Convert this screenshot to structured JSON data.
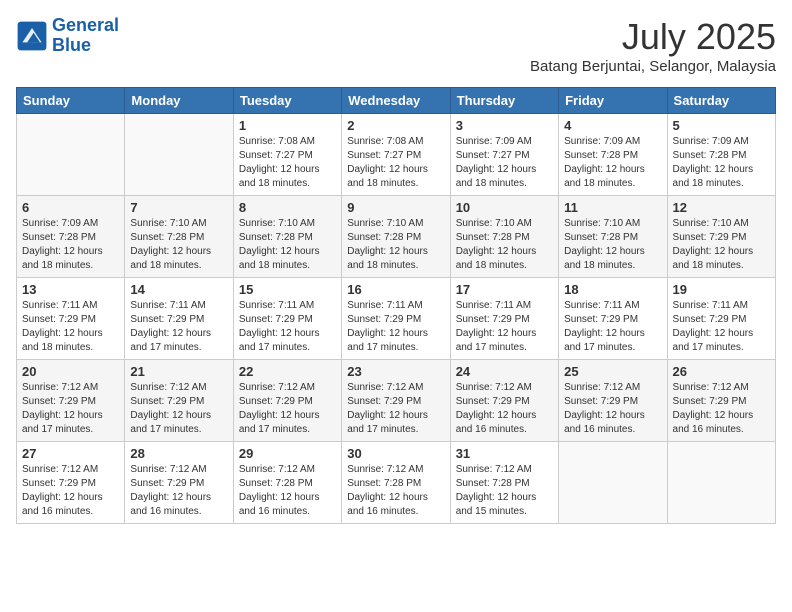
{
  "header": {
    "logo_line1": "General",
    "logo_line2": "Blue",
    "month_year": "July 2025",
    "location": "Batang Berjuntai, Selangor, Malaysia"
  },
  "weekdays": [
    "Sunday",
    "Monday",
    "Tuesday",
    "Wednesday",
    "Thursday",
    "Friday",
    "Saturday"
  ],
  "weeks": [
    [
      {
        "day": "",
        "info": ""
      },
      {
        "day": "",
        "info": ""
      },
      {
        "day": "1",
        "info": "Sunrise: 7:08 AM\nSunset: 7:27 PM\nDaylight: 12 hours and 18 minutes."
      },
      {
        "day": "2",
        "info": "Sunrise: 7:08 AM\nSunset: 7:27 PM\nDaylight: 12 hours and 18 minutes."
      },
      {
        "day": "3",
        "info": "Sunrise: 7:09 AM\nSunset: 7:27 PM\nDaylight: 12 hours and 18 minutes."
      },
      {
        "day": "4",
        "info": "Sunrise: 7:09 AM\nSunset: 7:28 PM\nDaylight: 12 hours and 18 minutes."
      },
      {
        "day": "5",
        "info": "Sunrise: 7:09 AM\nSunset: 7:28 PM\nDaylight: 12 hours and 18 minutes."
      }
    ],
    [
      {
        "day": "6",
        "info": "Sunrise: 7:09 AM\nSunset: 7:28 PM\nDaylight: 12 hours and 18 minutes."
      },
      {
        "day": "7",
        "info": "Sunrise: 7:10 AM\nSunset: 7:28 PM\nDaylight: 12 hours and 18 minutes."
      },
      {
        "day": "8",
        "info": "Sunrise: 7:10 AM\nSunset: 7:28 PM\nDaylight: 12 hours and 18 minutes."
      },
      {
        "day": "9",
        "info": "Sunrise: 7:10 AM\nSunset: 7:28 PM\nDaylight: 12 hours and 18 minutes."
      },
      {
        "day": "10",
        "info": "Sunrise: 7:10 AM\nSunset: 7:28 PM\nDaylight: 12 hours and 18 minutes."
      },
      {
        "day": "11",
        "info": "Sunrise: 7:10 AM\nSunset: 7:28 PM\nDaylight: 12 hours and 18 minutes."
      },
      {
        "day": "12",
        "info": "Sunrise: 7:10 AM\nSunset: 7:29 PM\nDaylight: 12 hours and 18 minutes."
      }
    ],
    [
      {
        "day": "13",
        "info": "Sunrise: 7:11 AM\nSunset: 7:29 PM\nDaylight: 12 hours and 18 minutes."
      },
      {
        "day": "14",
        "info": "Sunrise: 7:11 AM\nSunset: 7:29 PM\nDaylight: 12 hours and 17 minutes."
      },
      {
        "day": "15",
        "info": "Sunrise: 7:11 AM\nSunset: 7:29 PM\nDaylight: 12 hours and 17 minutes."
      },
      {
        "day": "16",
        "info": "Sunrise: 7:11 AM\nSunset: 7:29 PM\nDaylight: 12 hours and 17 minutes."
      },
      {
        "day": "17",
        "info": "Sunrise: 7:11 AM\nSunset: 7:29 PM\nDaylight: 12 hours and 17 minutes."
      },
      {
        "day": "18",
        "info": "Sunrise: 7:11 AM\nSunset: 7:29 PM\nDaylight: 12 hours and 17 minutes."
      },
      {
        "day": "19",
        "info": "Sunrise: 7:11 AM\nSunset: 7:29 PM\nDaylight: 12 hours and 17 minutes."
      }
    ],
    [
      {
        "day": "20",
        "info": "Sunrise: 7:12 AM\nSunset: 7:29 PM\nDaylight: 12 hours and 17 minutes."
      },
      {
        "day": "21",
        "info": "Sunrise: 7:12 AM\nSunset: 7:29 PM\nDaylight: 12 hours and 17 minutes."
      },
      {
        "day": "22",
        "info": "Sunrise: 7:12 AM\nSunset: 7:29 PM\nDaylight: 12 hours and 17 minutes."
      },
      {
        "day": "23",
        "info": "Sunrise: 7:12 AM\nSunset: 7:29 PM\nDaylight: 12 hours and 17 minutes."
      },
      {
        "day": "24",
        "info": "Sunrise: 7:12 AM\nSunset: 7:29 PM\nDaylight: 12 hours and 16 minutes."
      },
      {
        "day": "25",
        "info": "Sunrise: 7:12 AM\nSunset: 7:29 PM\nDaylight: 12 hours and 16 minutes."
      },
      {
        "day": "26",
        "info": "Sunrise: 7:12 AM\nSunset: 7:29 PM\nDaylight: 12 hours and 16 minutes."
      }
    ],
    [
      {
        "day": "27",
        "info": "Sunrise: 7:12 AM\nSunset: 7:29 PM\nDaylight: 12 hours and 16 minutes."
      },
      {
        "day": "28",
        "info": "Sunrise: 7:12 AM\nSunset: 7:29 PM\nDaylight: 12 hours and 16 minutes."
      },
      {
        "day": "29",
        "info": "Sunrise: 7:12 AM\nSunset: 7:28 PM\nDaylight: 12 hours and 16 minutes."
      },
      {
        "day": "30",
        "info": "Sunrise: 7:12 AM\nSunset: 7:28 PM\nDaylight: 12 hours and 16 minutes."
      },
      {
        "day": "31",
        "info": "Sunrise: 7:12 AM\nSunset: 7:28 PM\nDaylight: 12 hours and 15 minutes."
      },
      {
        "day": "",
        "info": ""
      },
      {
        "day": "",
        "info": ""
      }
    ]
  ]
}
